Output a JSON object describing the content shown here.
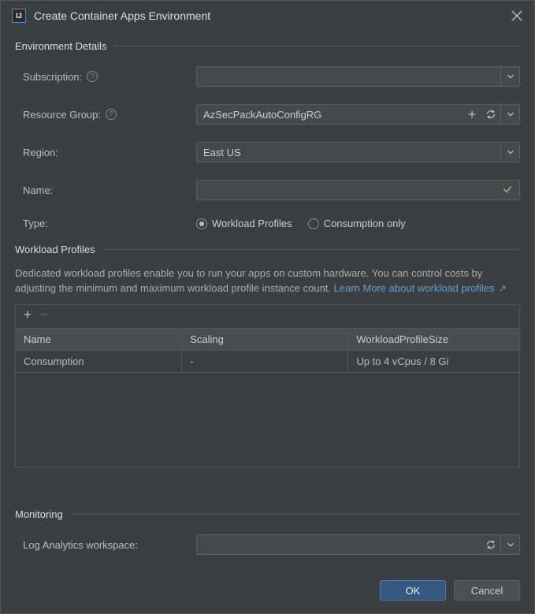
{
  "window": {
    "title": "Create Container Apps Environment"
  },
  "sections": {
    "env": {
      "title": "Environment Details"
    },
    "wp": {
      "title": "Workload Profiles"
    },
    "mon": {
      "title": "Monitoring"
    }
  },
  "form": {
    "subscription_label": "Subscription:",
    "subscription_value": "",
    "rg_label": "Resource Group:",
    "rg_value": "AzSecPackAutoConfigRG",
    "region_label": "Region:",
    "region_value": "East US",
    "name_label": "Name:",
    "name_value": "",
    "type_label": "Type:",
    "type_opt1": "Workload Profiles",
    "type_opt2": "Consumption only"
  },
  "wp_desc": {
    "text": "Dedicated workload profiles enable you to run your apps on custom hardware. You can control costs by adjusting the minimum and maximum workload profile instance count. ",
    "link": "Learn More about workload profiles"
  },
  "table": {
    "cols": {
      "c1": "Name",
      "c2": "Scaling",
      "c3": "WorkloadProfileSize"
    },
    "rows": [
      {
        "c1": "Consumption",
        "c2": "-",
        "c3": "Up to 4 vCpus / 8 Gi"
      }
    ]
  },
  "mon": {
    "law_label": "Log Analytics workspace:",
    "law_value": ""
  },
  "buttons": {
    "ok": "OK",
    "cancel": "Cancel"
  }
}
